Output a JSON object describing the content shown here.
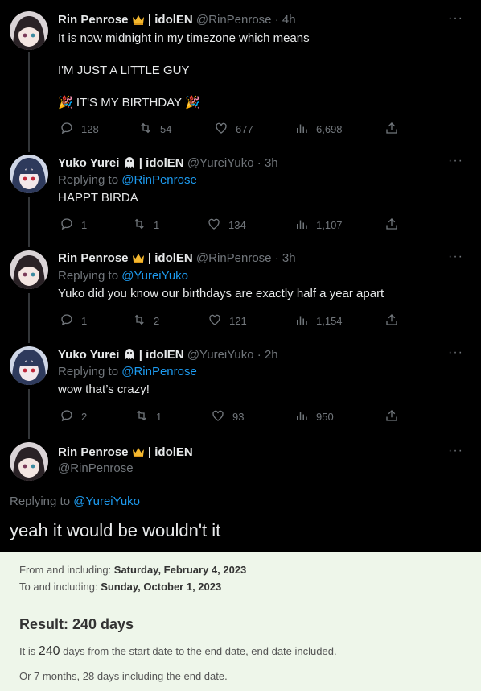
{
  "tweets": [
    {
      "name": "Rin Penrose",
      "org": " | idolEN",
      "handle": "@RinPenrose",
      "time": "· 4h",
      "lines": "It is now midnight in my timezone which means\n\nI'M JUST A LITTLE GUY\n\n🎉 IT'S MY BIRTHDAY 🎉",
      "replies": "128",
      "retweets": "54",
      "likes": "677",
      "views": "6,698"
    },
    {
      "name": "Yuko Yurei",
      "org": " | idolEN",
      "handle": "@YureiYuko",
      "time": "· 3h",
      "replying_label": "Replying to ",
      "replying_to": "@RinPenrose",
      "lines": "HAPPT BIRDA",
      "replies": "1",
      "retweets": "1",
      "likes": "134",
      "views": "1,107"
    },
    {
      "name": "Rin Penrose",
      "org": " | idolEN",
      "handle": "@RinPenrose",
      "time": "· 3h",
      "replying_label": "Replying to ",
      "replying_to": "@YureiYuko",
      "lines": "Yuko did you know our birthdays are exactly half a year apart",
      "replies": "1",
      "retweets": "2",
      "likes": "121",
      "views": "1,154"
    },
    {
      "name": "Yuko Yurei",
      "org": " | idolEN",
      "handle": "@YureiYuko",
      "time": "· 2h",
      "replying_label": "Replying to ",
      "replying_to": "@RinPenrose",
      "lines": "wow that’s crazy!",
      "replies": "2",
      "retweets": "1",
      "likes": "93",
      "views": "950"
    }
  ],
  "main_tweet": {
    "name": "Rin Penrose",
    "org": " | idolEN",
    "handle": "@RinPenrose",
    "replying_label": "Replying to ",
    "replying_to": "@YureiYuko",
    "text": "yeah it would be wouldn't it"
  },
  "more_label": "···",
  "calculator": {
    "from_label": "From and including: ",
    "from_value": "Saturday, February 4, 2023",
    "to_label": "To and including: ",
    "to_value": "Sunday, October 1, 2023",
    "result": "Result: 240 days",
    "sentence_prefix": "It is ",
    "sentence_number": "240",
    "sentence_suffix": " days from the start date to the end date, end date included.",
    "alt": "Or 7 months, 28 days including the end date."
  },
  "colors": {
    "background": "#000000",
    "text": "#e7e9ea",
    "muted": "#71767b",
    "link": "#1d9bf0",
    "calc_background": "#eef6ea"
  }
}
